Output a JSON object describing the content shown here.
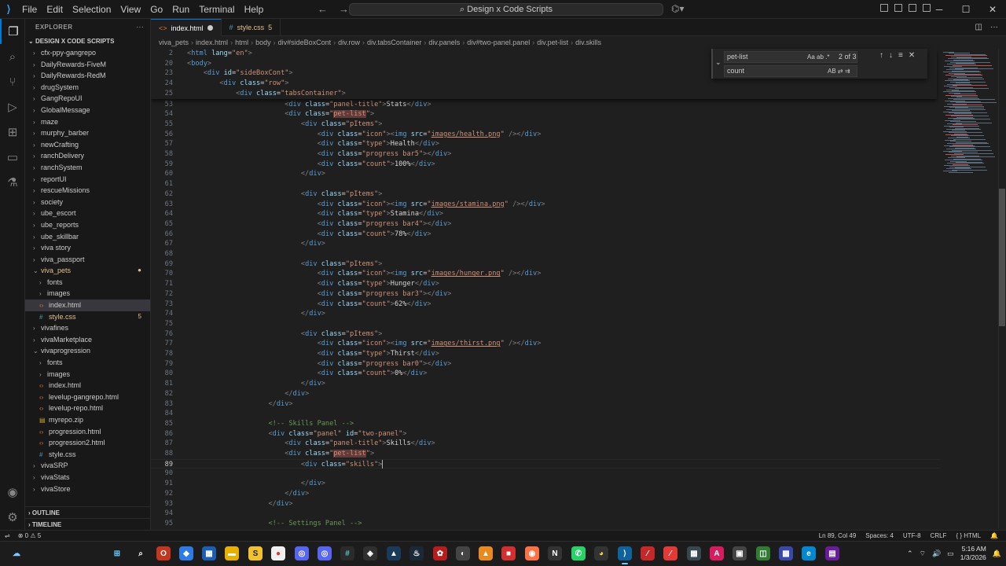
{
  "titlebar": {
    "menu": [
      "File",
      "Edit",
      "Selection",
      "View",
      "Go",
      "Run",
      "Terminal",
      "Help"
    ],
    "search_text": "Design x Code Scripts"
  },
  "sidebar": {
    "header": "EXPLORER",
    "root": "DESIGN X CODE SCRIPTS",
    "items": [
      {
        "label": "cfx-ppy-gangrepo",
        "type": "folder",
        "depth": 1
      },
      {
        "label": "DailyRewards-FiveM",
        "type": "folder",
        "depth": 1
      },
      {
        "label": "DailyRewards-RedM",
        "type": "folder",
        "depth": 1
      },
      {
        "label": "drugSystem",
        "type": "folder",
        "depth": 1
      },
      {
        "label": "GangRepoUI",
        "type": "folder",
        "depth": 1
      },
      {
        "label": "GlobalMessage",
        "type": "folder",
        "depth": 1
      },
      {
        "label": "maze",
        "type": "folder",
        "depth": 1
      },
      {
        "label": "murphy_barber",
        "type": "folder",
        "depth": 1
      },
      {
        "label": "newCrafting",
        "type": "folder",
        "depth": 1
      },
      {
        "label": "ranchDelivery",
        "type": "folder",
        "depth": 1
      },
      {
        "label": "ranchSystem",
        "type": "folder",
        "depth": 1
      },
      {
        "label": "reportUI",
        "type": "folder",
        "depth": 1
      },
      {
        "label": "rescueMissions",
        "type": "folder",
        "depth": 1
      },
      {
        "label": "society",
        "type": "folder",
        "depth": 1
      },
      {
        "label": "ube_escort",
        "type": "folder",
        "depth": 1
      },
      {
        "label": "ube_reports",
        "type": "folder",
        "depth": 1
      },
      {
        "label": "ube_skillbar",
        "type": "folder",
        "depth": 1
      },
      {
        "label": "viva story",
        "type": "folder",
        "depth": 1
      },
      {
        "label": "viva_passport",
        "type": "folder",
        "depth": 1
      },
      {
        "label": "viva_pets",
        "type": "folder-open",
        "depth": 1,
        "modified": true,
        "badge": "●"
      },
      {
        "label": "fonts",
        "type": "folder",
        "depth": 2
      },
      {
        "label": "images",
        "type": "folder",
        "depth": 2
      },
      {
        "label": "index.html",
        "type": "html",
        "depth": 2,
        "selected": true
      },
      {
        "label": "style.css",
        "type": "css",
        "depth": 2,
        "modified": true,
        "badge": "5"
      },
      {
        "label": "vivafines",
        "type": "folder",
        "depth": 1
      },
      {
        "label": "vivaMarketplace",
        "type": "folder",
        "depth": 1
      },
      {
        "label": "vivaprogression",
        "type": "folder-open",
        "depth": 1
      },
      {
        "label": "fonts",
        "type": "folder",
        "depth": 2
      },
      {
        "label": "images",
        "type": "folder",
        "depth": 2
      },
      {
        "label": "index.html",
        "type": "html",
        "depth": 2
      },
      {
        "label": "levelup-gangrepo.html",
        "type": "html",
        "depth": 2
      },
      {
        "label": "levelup-repo.html",
        "type": "html",
        "depth": 2
      },
      {
        "label": "myrepo.zip",
        "type": "zip",
        "depth": 2
      },
      {
        "label": "progression.html",
        "type": "html",
        "depth": 2
      },
      {
        "label": "progression2.html",
        "type": "html",
        "depth": 2
      },
      {
        "label": "style.css",
        "type": "css",
        "depth": 2
      },
      {
        "label": "vivaSRP",
        "type": "folder",
        "depth": 1
      },
      {
        "label": "vivaStats",
        "type": "folder",
        "depth": 1
      },
      {
        "label": "vivaStore",
        "type": "folder",
        "depth": 1
      }
    ],
    "outline": "OUTLINE",
    "timeline": "TIMELINE"
  },
  "tabs": [
    {
      "label": "index.html",
      "icon": "html-icon",
      "active": true,
      "dirty": true
    },
    {
      "label": "style.css",
      "icon": "css-icon",
      "active": false,
      "badge": "5"
    }
  ],
  "breadcrumbs": [
    "viva_pets",
    "index.html",
    "html",
    "body",
    "div#sideBoxCont",
    "div.row",
    "div.tabsContainer",
    "div.panels",
    "div#two-panel.panel",
    "div.pet-list",
    "div.skills"
  ],
  "find": {
    "query": "pet-list",
    "replace": "count",
    "result": "2 of 3",
    "opt_case": "Aa",
    "opt_word": "ab",
    "opt_regex": ".*",
    "opt_preserve": "AB"
  },
  "sticky": [
    {
      "n": "2",
      "code": "<html lang=\"en\">"
    },
    {
      "n": "20",
      "code": "<body>"
    },
    {
      "n": "23",
      "code": "    <div id=\"sideBoxCont\">"
    },
    {
      "n": "24",
      "code": "        <div class=\"row\">"
    },
    {
      "n": "25",
      "code": "            <div class=\"tabsContainer\">"
    }
  ],
  "code": [
    {
      "n": "53",
      "code": "                        <div class=\"panel-title\">Stats</div>"
    },
    {
      "n": "54",
      "code": "                        <div class=\"pet-list\">"
    },
    {
      "n": "55",
      "code": "                            <div class=\"pItems\">"
    },
    {
      "n": "56",
      "code": "                                <div class=\"icon\"><img src=\"images/health.png\" /></div>"
    },
    {
      "n": "57",
      "code": "                                <div class=\"type\">Health</div>"
    },
    {
      "n": "58",
      "code": "                                <div class=\"progress bar5\"></div>"
    },
    {
      "n": "59",
      "code": "                                <div class=\"count\">100%</div>"
    },
    {
      "n": "60",
      "code": "                            </div>"
    },
    {
      "n": "61",
      "code": ""
    },
    {
      "n": "62",
      "code": "                            <div class=\"pItems\">"
    },
    {
      "n": "63",
      "code": "                                <div class=\"icon\"><img src=\"images/stamina.png\" /></div>"
    },
    {
      "n": "64",
      "code": "                                <div class=\"type\">Stamina</div>"
    },
    {
      "n": "65",
      "code": "                                <div class=\"progress bar4\"></div>"
    },
    {
      "n": "66",
      "code": "                                <div class=\"count\">78%</div>"
    },
    {
      "n": "67",
      "code": "                            </div>"
    },
    {
      "n": "68",
      "code": ""
    },
    {
      "n": "69",
      "code": "                            <div class=\"pItems\">"
    },
    {
      "n": "70",
      "code": "                                <div class=\"icon\"><img src=\"images/hunger.png\" /></div>"
    },
    {
      "n": "71",
      "code": "                                <div class=\"type\">Hunger</div>"
    },
    {
      "n": "72",
      "code": "                                <div class=\"progress bar3\"></div>"
    },
    {
      "n": "73",
      "code": "                                <div class=\"count\">62%</div>"
    },
    {
      "n": "74",
      "code": "                            </div>"
    },
    {
      "n": "75",
      "code": ""
    },
    {
      "n": "76",
      "code": "                            <div class=\"pItems\">"
    },
    {
      "n": "77",
      "code": "                                <div class=\"icon\"><img src=\"images/thirst.png\" /></div>"
    },
    {
      "n": "78",
      "code": "                                <div class=\"type\">Thirst</div>"
    },
    {
      "n": "79",
      "code": "                                <div class=\"progress bar0\"></div>"
    },
    {
      "n": "80",
      "code": "                                <div class=\"count\">0%</div>"
    },
    {
      "n": "81",
      "code": "                            </div>"
    },
    {
      "n": "82",
      "code": "                        </div>"
    },
    {
      "n": "83",
      "code": "                    </div>"
    },
    {
      "n": "84",
      "code": ""
    },
    {
      "n": "85",
      "code": "                    <!-- Skills Panel -->"
    },
    {
      "n": "86",
      "code": "                    <div class=\"panel\" id=\"two-panel\">"
    },
    {
      "n": "87",
      "code": "                        <div class=\"panel-title\">Skills</div>"
    },
    {
      "n": "88",
      "code": "                        <div class=\"pet-list\">"
    },
    {
      "n": "89",
      "code": "                            <div class=\"skills\">"
    },
    {
      "n": "90",
      "code": ""
    },
    {
      "n": "91",
      "code": "                            </div>"
    },
    {
      "n": "92",
      "code": "                        </div>"
    },
    {
      "n": "93",
      "code": "                    </div>"
    },
    {
      "n": "94",
      "code": ""
    },
    {
      "n": "95",
      "code": "                    <!-- Settings Panel -->"
    }
  ],
  "status": {
    "errors": "0",
    "warnings": "5",
    "position": "Ln 89, Col 49",
    "spaces": "Spaces: 4",
    "encoding": "UTF-8",
    "eol": "CRLF",
    "language": "HTML"
  },
  "taskbar": {
    "time": "5:16 AM",
    "date": "1/3/2026"
  }
}
